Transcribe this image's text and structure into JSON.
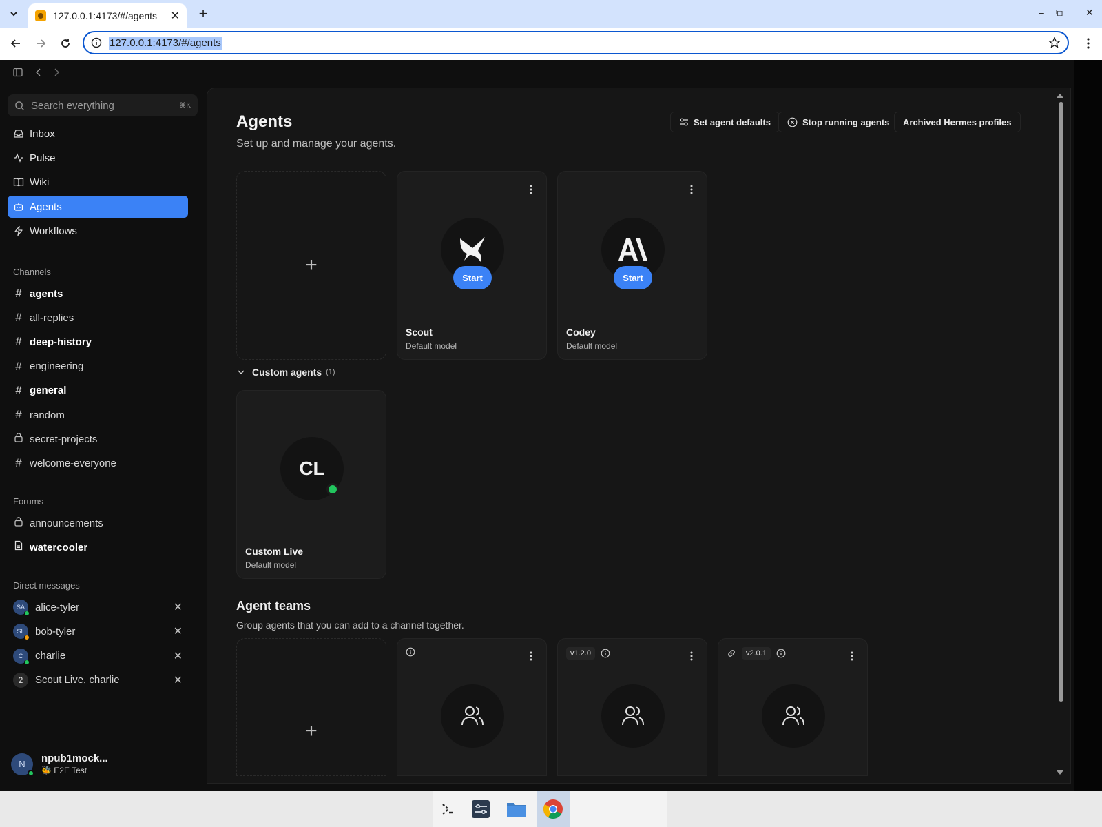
{
  "browser": {
    "tab_title": "127.0.0.1:4173/#/agents",
    "url": "127.0.0.1:4173/#/agents",
    "window_controls": {
      "minimize": "–",
      "restore": "⧉",
      "close": "✕"
    }
  },
  "sidebar": {
    "search_placeholder": "Search everything",
    "search_shortcut": "⌘K",
    "nav": [
      {
        "label": "Inbox",
        "icon": "inbox-icon"
      },
      {
        "label": "Pulse",
        "icon": "pulse-icon"
      },
      {
        "label": "Wiki",
        "icon": "book-icon"
      },
      {
        "label": "Agents",
        "icon": "bot-icon",
        "active": true
      },
      {
        "label": "Workflows",
        "icon": "bolt-icon"
      }
    ],
    "channels_label": "Channels",
    "channels": [
      {
        "name": "agents",
        "bold": true,
        "icon": "hash"
      },
      {
        "name": "all-replies",
        "bold": false,
        "icon": "hash"
      },
      {
        "name": "deep-history",
        "bold": true,
        "icon": "hash"
      },
      {
        "name": "engineering",
        "bold": false,
        "icon": "hash"
      },
      {
        "name": "general",
        "bold": true,
        "icon": "hash"
      },
      {
        "name": "random",
        "bold": false,
        "icon": "hash"
      },
      {
        "name": "secret-projects",
        "bold": false,
        "icon": "lock"
      },
      {
        "name": "welcome-everyone",
        "bold": false,
        "icon": "hash"
      }
    ],
    "forums_label": "Forums",
    "forums": [
      {
        "name": "announcements",
        "bold": false,
        "icon": "lock"
      },
      {
        "name": "watercooler",
        "bold": true,
        "icon": "doc"
      }
    ],
    "dms_label": "Direct messages",
    "dms": [
      {
        "initials": "SA",
        "name": "alice-tyler",
        "status_color": "#22c55e"
      },
      {
        "initials": "SL",
        "name": "bob-tyler",
        "status_color": "#f59e0b"
      },
      {
        "initials": "C",
        "name": "charlie",
        "status_color": "#22c55e"
      },
      {
        "initials": "2",
        "name": "Scout Live, charlie",
        "group": true
      }
    ],
    "user": {
      "initial": "N",
      "name": "npub1mock...",
      "status": "🐝 E2E Test"
    }
  },
  "main": {
    "title": "Agents",
    "subtitle": "Set up and manage your agents.",
    "buttons": {
      "defaults": "Set agent defaults",
      "stop": "Stop running agents",
      "archived": "Archived Hermes profiles"
    },
    "agents": [
      {
        "name": "Scout",
        "model": "Default model",
        "start": "Start"
      },
      {
        "name": "Codey",
        "model": "Default model",
        "start": "Start"
      }
    ],
    "custom_section": {
      "label": "Custom agents",
      "count": "(1)"
    },
    "custom_agents": [
      {
        "initials": "CL",
        "name": "Custom Live",
        "model": "Default model"
      }
    ],
    "teams_title": "Agent teams",
    "teams_subtitle": "Group agents that you can add to a channel together.",
    "teams": [
      {
        "version": ""
      },
      {
        "version": "v1.2.0"
      },
      {
        "version": "v2.0.1",
        "linked": true
      }
    ]
  },
  "colors": {
    "accent": "#3b82f6",
    "online": "#22c55e"
  }
}
